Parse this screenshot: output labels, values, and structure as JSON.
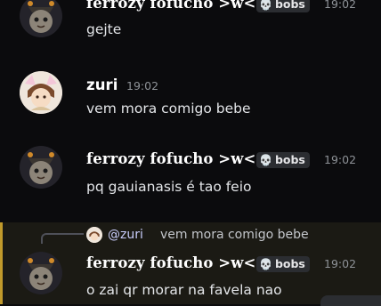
{
  "messages": [
    {
      "author": "ferrozy fofucho >w<",
      "tag": "bobs",
      "time": "19:02",
      "text": "gejte"
    },
    {
      "author": "zuri",
      "time": "19:02",
      "text": "vem mora comigo bebe"
    },
    {
      "author": "ferrozy fofucho >w<",
      "tag": "bobs",
      "time": "19:02",
      "text": "pq gauianasis é tao feio"
    },
    {
      "author": "ferrozy fofucho >w<",
      "tag": "bobs",
      "time": "19:02",
      "text": "o zai qr morar na favela nao",
      "reply": {
        "mention": "@zuri",
        "text": "vem mora comigo bebe"
      }
    }
  ],
  "tag_icon": "skull-icon",
  "colors": {
    "background": "#0b0b0d",
    "highlight": "#1b1a14",
    "highlight_border": "#c19a2b",
    "mention": "#c9cdfb"
  }
}
